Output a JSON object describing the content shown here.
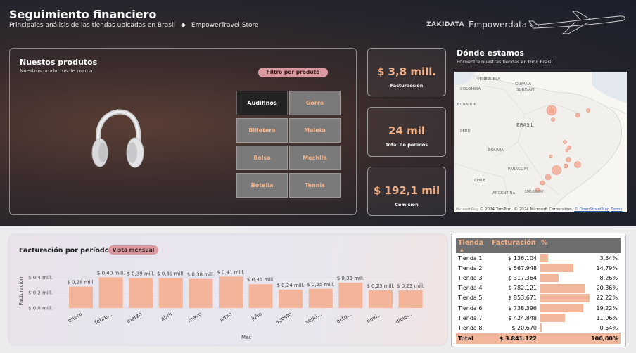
{
  "header": {
    "title": "Seguimiento financiero",
    "subtitle": "Principales análisis de las tiendas ubicadas en Brasil",
    "separator": "◆",
    "store": "EmpowerTravel Store",
    "brand_zaki": "ZAKIDATA",
    "brand_emp": "Empowerdata"
  },
  "products": {
    "title": "Nuestos produtos",
    "subtitle": "Nuestros productos de marca",
    "filter_label": "Filtro por produto",
    "items": [
      {
        "label": "Audifinos",
        "active": true
      },
      {
        "label": "Gorra",
        "active": false
      },
      {
        "label": "Billetera",
        "active": false
      },
      {
        "label": "Maleta",
        "active": false
      },
      {
        "label": "Bolso",
        "active": false
      },
      {
        "label": "Mochila",
        "active": false
      },
      {
        "label": "Botella",
        "active": false
      },
      {
        "label": "Tennis",
        "active": false
      }
    ]
  },
  "kpis": [
    {
      "value": "$ 3,8 mill.",
      "label": "Facturacción"
    },
    {
      "value": "24 mil",
      "label": "Total de pedidos"
    },
    {
      "value": "$ 192,1 mil",
      "label": "Comisión"
    }
  ],
  "map": {
    "title": "Dónde estamos",
    "subtitle": "Encuentre nuestras tiendas en todo Brasil",
    "labels": [
      "VENEZUELA",
      "COLOMBIA",
      "GUYANA",
      "SURINAM",
      "ECUADOR",
      "PERÚ",
      "BRASIL",
      "BOLIVIA",
      "PARAGUAY",
      "CHILE",
      "ARGENTINA",
      "URUGUAY"
    ],
    "attribution_ms": "Microsoft Bing",
    "attribution": "© 2024 TomTom, © 2024 Microsoft Corporation, ",
    "attribution_osm": "© OpenStreetMap",
    "attribution_terms": "Terms"
  },
  "billing": {
    "title": "Facturación por período",
    "view_label": "Vista mensual"
  },
  "chart_data": {
    "type": "bar",
    "categories": [
      "enero",
      "febre...",
      "marzo",
      "abril",
      "mayo",
      "junio",
      "julio",
      "agosto",
      "septi...",
      "octu...",
      "novi...",
      "dicie..."
    ],
    "values": [
      0.28,
      0.4,
      0.39,
      0.39,
      0.38,
      0.41,
      0.31,
      0.24,
      0.25,
      0.33,
      0.23,
      0.23
    ],
    "data_labels": [
      "$ 0,28 mill.",
      "$ 0,40 mill.",
      "$ 0,39 mill.",
      "$ 0,39 mill.",
      "$ 0,38 mill.",
      "$ 0,41 mill.",
      "$ 0,31 mill.",
      "$ 0,24 mill.",
      "$ 0,25 mill.",
      "$ 0,33 mill.",
      "$ 0,23 mill.",
      "$ 0,23 mill."
    ],
    "yticks": [
      0,
      0.2,
      0.4
    ],
    "ytick_labels": [
      "$ 0,0 mill.",
      "$ 0,2 mill.",
      "$ 0,4 mill."
    ],
    "ylim": [
      0,
      0.45
    ],
    "xlabel": "Mes",
    "ylabel": "Facturación",
    "color": "#f4b49a"
  },
  "table": {
    "headers": [
      "Tienda",
      "Facturación",
      "%"
    ],
    "rows": [
      {
        "store": "Tienda 1",
        "revenue": "$ 136.104",
        "pct": "3,54%",
        "share": 0.0354
      },
      {
        "store": "Tienda 2",
        "revenue": "$ 567.948",
        "pct": "14,79%",
        "share": 0.1479
      },
      {
        "store": "Tienda 3",
        "revenue": "$ 317.364",
        "pct": "8,26%",
        "share": 0.0826
      },
      {
        "store": "Tienda 4",
        "revenue": "$ 782.121",
        "pct": "20,36%",
        "share": 0.2036
      },
      {
        "store": "Tienda 5",
        "revenue": "$ 853.671",
        "pct": "22,22%",
        "share": 0.2222
      },
      {
        "store": "Tienda 6",
        "revenue": "$ 738.396",
        "pct": "19,22%",
        "share": 0.1922
      },
      {
        "store": "Tienda 7",
        "revenue": "$ 424.848",
        "pct": "11,06%",
        "share": 0.1106
      },
      {
        "store": "Tienda 8",
        "revenue": "$ 20.670",
        "pct": "0,54%",
        "share": 0.0054
      }
    ],
    "total": {
      "store": "Total",
      "revenue": "$ 3.841.122",
      "pct": "100,00%"
    }
  }
}
